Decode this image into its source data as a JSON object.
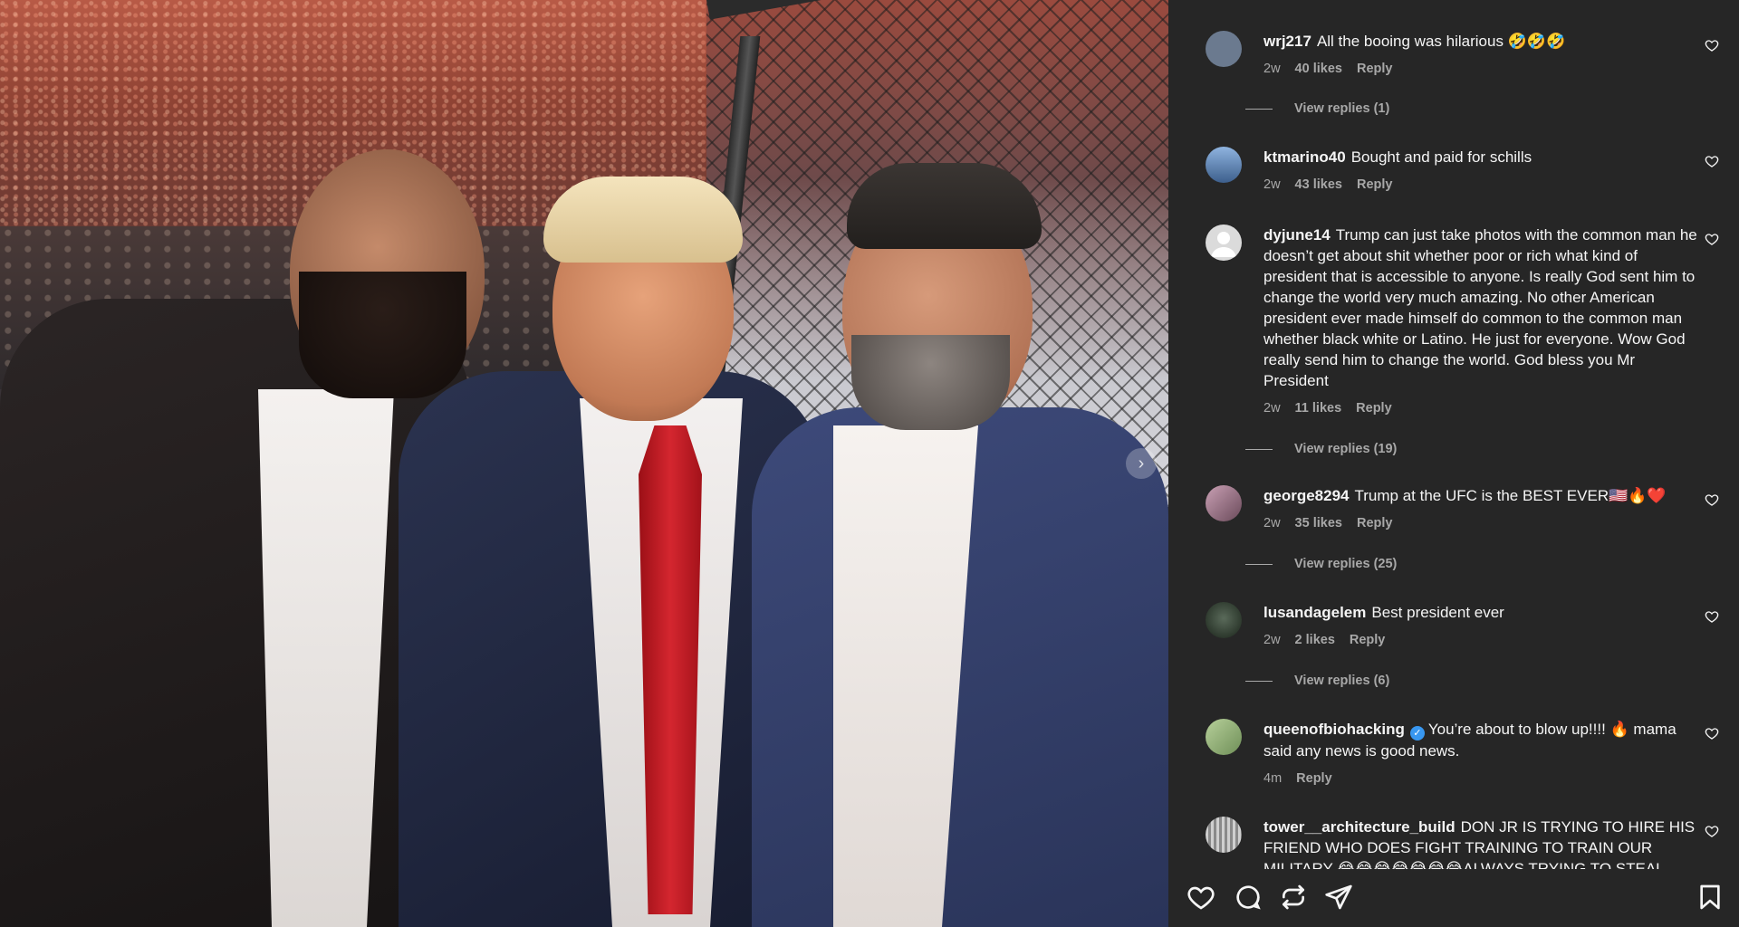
{
  "photo": {
    "next_icon": "chevron-right-icon"
  },
  "comments": [
    {
      "username": "wrj217",
      "text": "All the booing was hilarious 🤣🤣🤣",
      "time": "2w",
      "likes": "40 likes",
      "reply": "Reply",
      "view_replies": "View replies (1)",
      "avatar_color": "#6b7a8f"
    },
    {
      "username": "ktmarino40",
      "text": "Bought and paid for schills",
      "time": "2w",
      "likes": "43 likes",
      "reply": "Reply",
      "avatar_color": "#5b7fb0"
    },
    {
      "username": "dyjune14",
      "text": "Trump can just take photos with the common man he doesn’t get about shit whether poor or rich what kind of president that is accessible to anyone. Is really God sent him to change the world very much amazing. No other American president ever made himself do common to the common man whether black white or Latino. He just for everyone. Wow God really send him to change the world. God bless you Mr President",
      "time": "2w",
      "likes": "11 likes",
      "reply": "Reply",
      "view_replies": "View replies (19)",
      "avatar_color": "#dbdbdb"
    },
    {
      "username": "george8294",
      "text": "Trump at the UFC is the BEST EVER🇺🇸🔥❤️",
      "time": "2w",
      "likes": "35 likes",
      "reply": "Reply",
      "view_replies": "View replies (25)",
      "avatar_color": "#8a6a7a"
    },
    {
      "username": "lusandagelem",
      "text": "Best president ever",
      "time": "2w",
      "likes": "2 likes",
      "reply": "Reply",
      "view_replies": "View replies (6)",
      "avatar_color": "#3a4a3a"
    },
    {
      "username": "queenofbiohacking",
      "verified": true,
      "text": "You’re about to blow up!!!! 🔥 mama said any news is good news.",
      "time": "4m",
      "reply": "Reply",
      "avatar_color": "#8fae7a"
    },
    {
      "username": "tower__architecture_build",
      "text": "DON JR IS TRYING TO HIRE HIS FRIEND WHO DOES FIGHT TRAINING TO TRAIN OUR MILITARY 😂😂😂😂😂😂😂ALWAYS TRYING TO STEAL",
      "avatar_color": "#9a9a9a"
    }
  ],
  "actions": {
    "like_icon": "heart-icon",
    "comment_icon": "comment-icon",
    "repost_icon": "repost-icon",
    "share_icon": "send-icon",
    "save_icon": "bookmark-icon"
  }
}
